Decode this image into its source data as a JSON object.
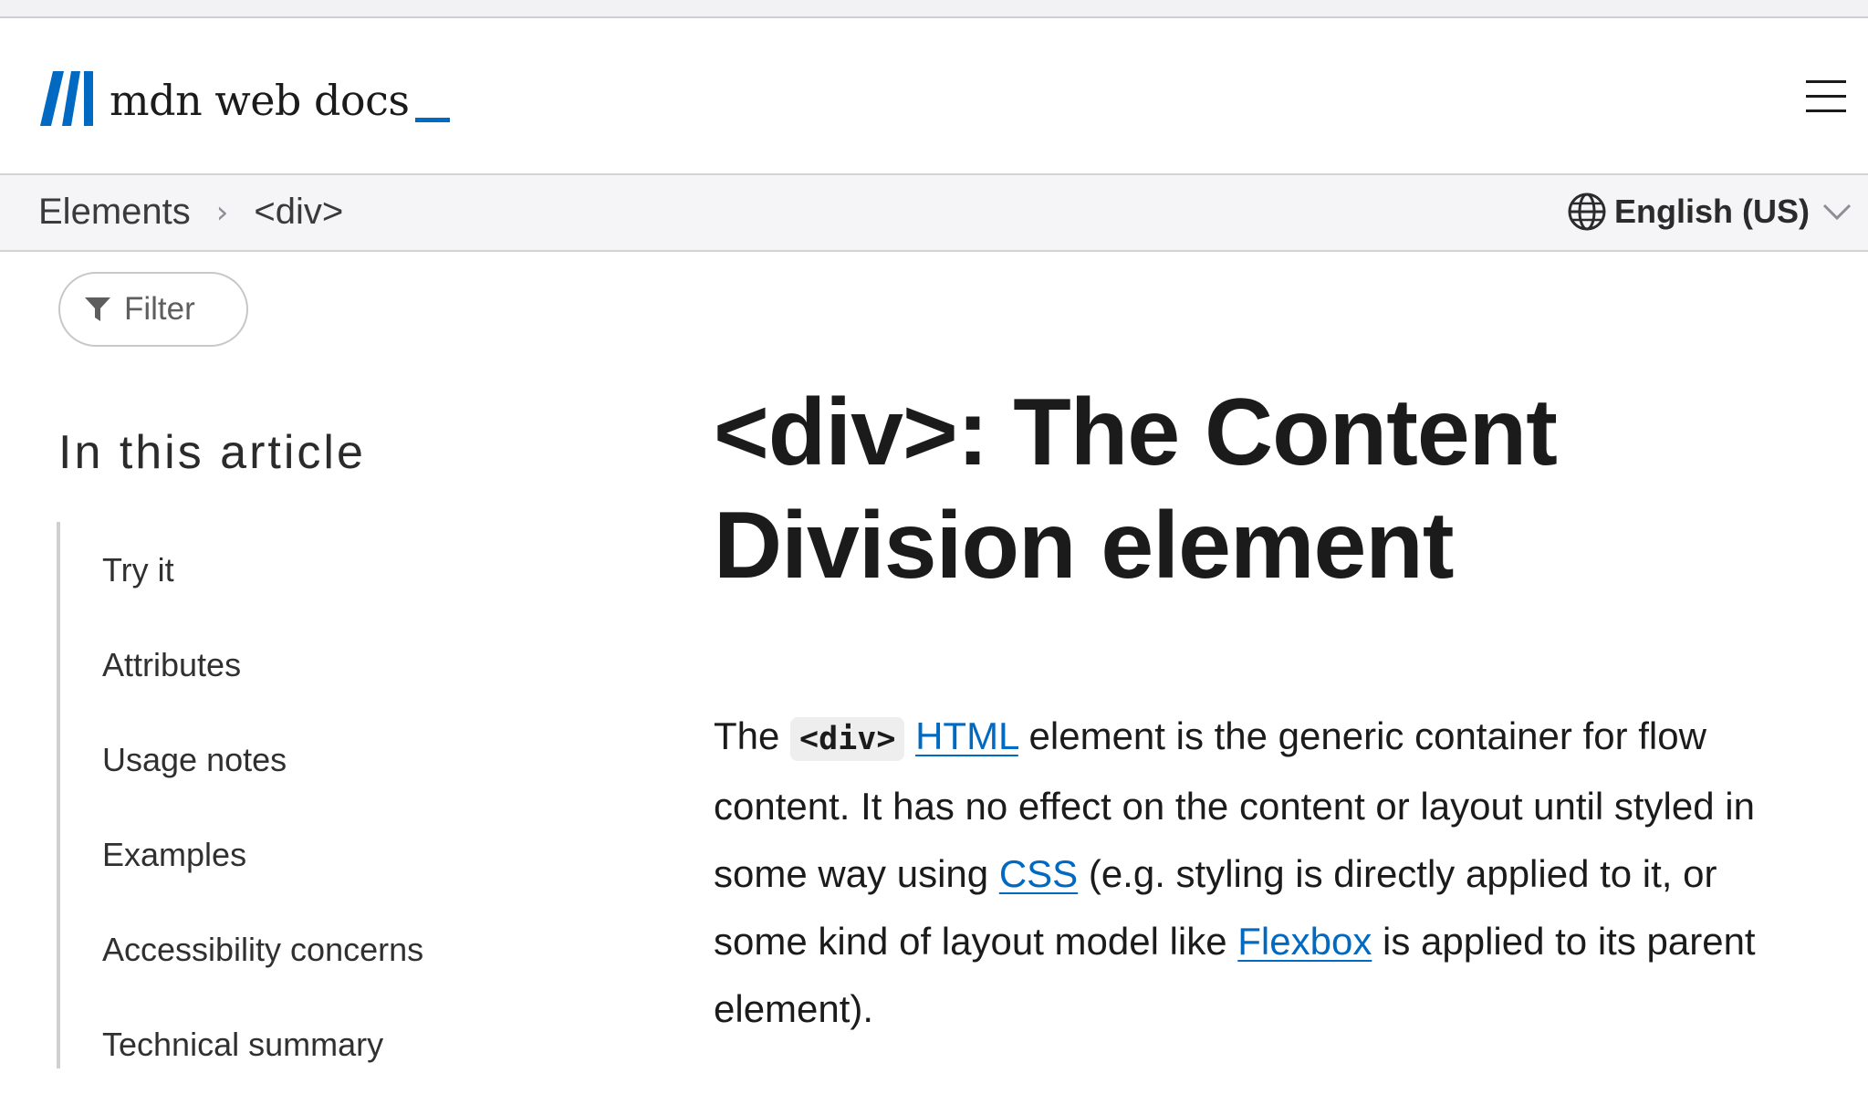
{
  "header": {
    "logo_text": "mdn web docs",
    "logo_mark": "mdn-logo-icon",
    "menu_icon": "hamburger-menu-icon"
  },
  "breadcrumb": {
    "items": [
      "Elements",
      "<div>"
    ],
    "separator": "›"
  },
  "language": {
    "label": "English (US)",
    "icon": "globe-icon",
    "chevron": "chevron-down-icon"
  },
  "sidebar": {
    "filter_label": "Filter",
    "filter_icon": "filter-icon",
    "toc_heading": "In this article",
    "toc_items": [
      "Try it",
      "Attributes",
      "Usage notes",
      "Examples",
      "Accessibility concerns",
      "Technical summary"
    ]
  },
  "article": {
    "title": "<div>: The Content Division element",
    "intro": {
      "t1": "The ",
      "code": "<div>",
      "t2": " ",
      "link_html": "HTML",
      "t3": " element is the generic container for flow content. It has no effect on the content or layout until styled in some way using ",
      "link_css": "CSS",
      "t4": " (e.g. styling is directly applied to it, or some kind of layout model like ",
      "link_flexbox": "Flexbox",
      "t5": " is applied to its parent element)."
    }
  },
  "colors": {
    "accent": "#0069c2",
    "text": "#1b1b1b",
    "bar_bg": "#f5f5f7",
    "border": "#d3d3d6"
  }
}
